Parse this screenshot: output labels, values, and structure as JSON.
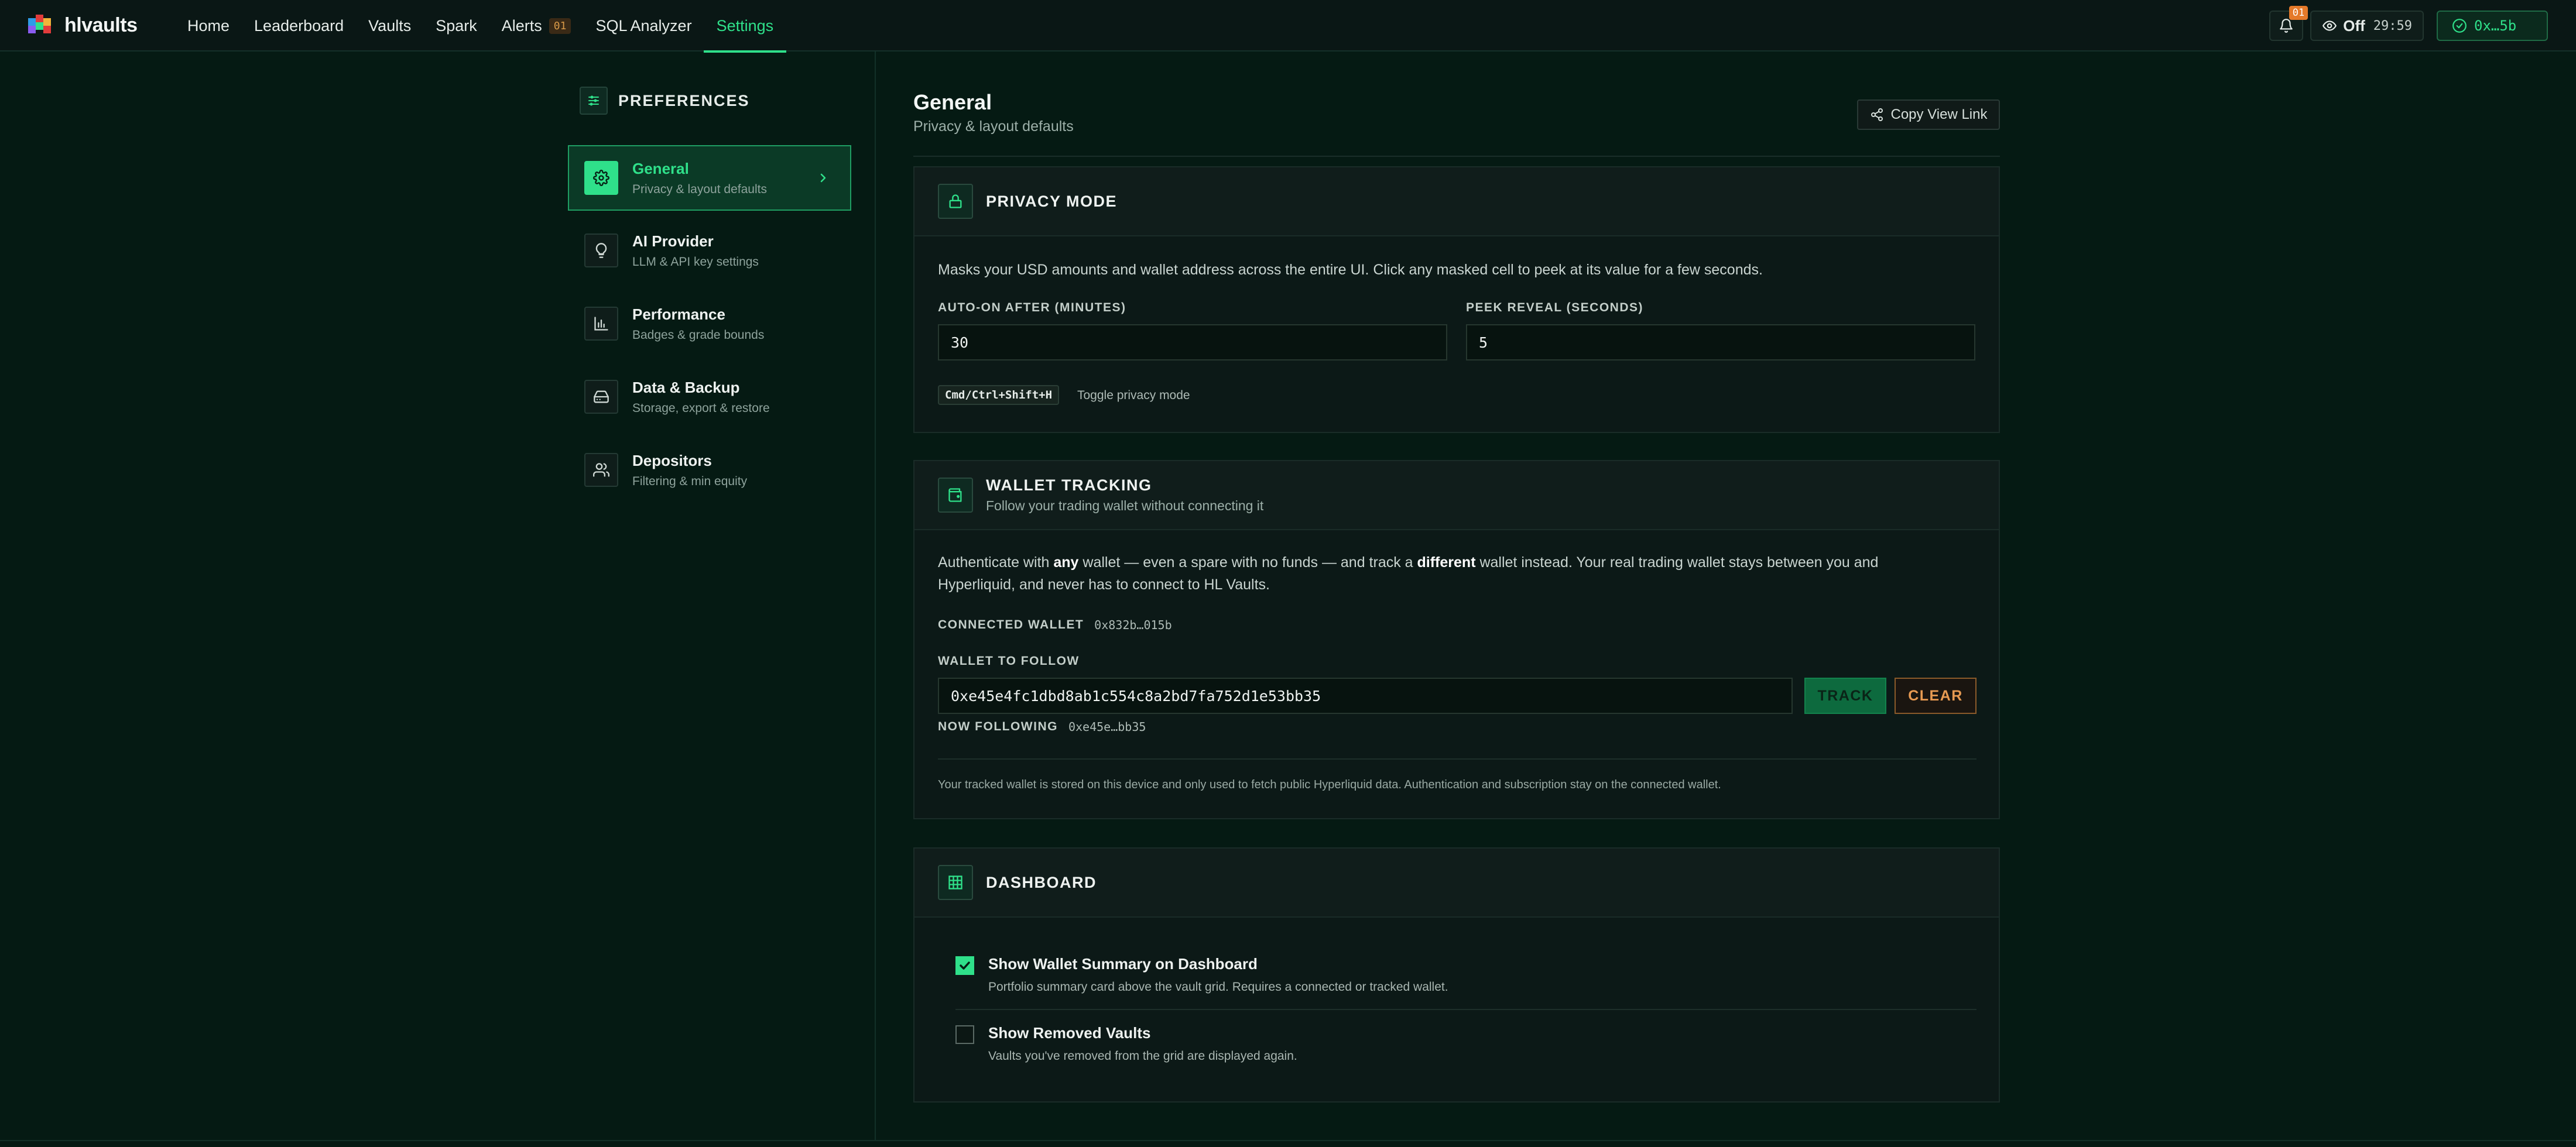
{
  "brand": {
    "name": "hlvaults"
  },
  "nav": {
    "items": [
      {
        "label": "Home"
      },
      {
        "label": "Leaderboard"
      },
      {
        "label": "Vaults"
      },
      {
        "label": "Spark"
      },
      {
        "label": "Alerts",
        "badge": "01"
      },
      {
        "label": "SQL Analyzer"
      },
      {
        "label": "Settings",
        "active": true
      }
    ]
  },
  "topbar": {
    "bell_badge": "01",
    "privacy_state": "Off",
    "privacy_timer": "29:59",
    "wallet": "0x…5b"
  },
  "sidebar": {
    "title": "PREFERENCES",
    "items": [
      {
        "label": "General",
        "sub": "Privacy & layout defaults",
        "icon": "gear-icon",
        "active": true
      },
      {
        "label": "AI Provider",
        "sub": "LLM & API key settings",
        "icon": "lightbulb-icon"
      },
      {
        "label": "Performance",
        "sub": "Badges & grade bounds",
        "icon": "bar-chart-icon"
      },
      {
        "label": "Data & Backup",
        "sub": "Storage, export & restore",
        "icon": "hard-drive-icon"
      },
      {
        "label": "Depositors",
        "sub": "Filtering & min equity",
        "icon": "users-icon"
      }
    ]
  },
  "main": {
    "title": "General",
    "subtitle": "Privacy & layout defaults",
    "copy_link_label": "Copy View Link"
  },
  "privacy": {
    "title": "PRIVACY MODE",
    "description": "Masks your USD amounts and wallet address across the entire UI. Click any masked cell to peek at its value for a few seconds.",
    "auto_on_label": "AUTO-ON AFTER (MINUTES)",
    "auto_on_value": "30",
    "peek_label": "PEEK REVEAL (SECONDS)",
    "peek_value": "5",
    "shortcut": "Cmd/Ctrl+Shift+H",
    "shortcut_hint": "Toggle privacy mode"
  },
  "wallet_tracking": {
    "title": "WALLET TRACKING",
    "subtitle": "Follow your trading wallet without connecting it",
    "desc_1": "Authenticate with ",
    "desc_bold_1": "any",
    "desc_2": " wallet — even a spare with no funds — and track a ",
    "desc_bold_2": "different",
    "desc_3": " wallet instead. Your real trading wallet stays between you and Hyperliquid, and never has to connect to HL Vaults.",
    "connected_label": "CONNECTED WALLET",
    "connected_value": "0x832b…015b",
    "follow_label": "WALLET TO FOLLOW",
    "follow_value": "0xe45e4fc1dbd8ab1c554c8a2bd7fa752d1e53bb35",
    "track_label": "TRACK",
    "clear_label": "CLEAR",
    "now_following_label": "NOW FOLLOWING",
    "now_following_value": "0xe45e…bb35",
    "footnote": "Your tracked wallet is stored on this device and only used to fetch public Hyperliquid data. Authentication and subscription stay on the connected wallet."
  },
  "dashboard": {
    "title": "DASHBOARD",
    "options": [
      {
        "label": "Show Wallet Summary on Dashboard",
        "sub": "Portfolio summary card above the vault grid. Requires a connected or tracked wallet.",
        "checked": true
      },
      {
        "label": "Show Removed Vaults",
        "sub": "Vaults you've removed from the grid are displayed again.",
        "checked": false
      }
    ]
  },
  "colors": {
    "accent": "#2fe08a",
    "background": "#051a13",
    "warning": "#e79a52"
  }
}
